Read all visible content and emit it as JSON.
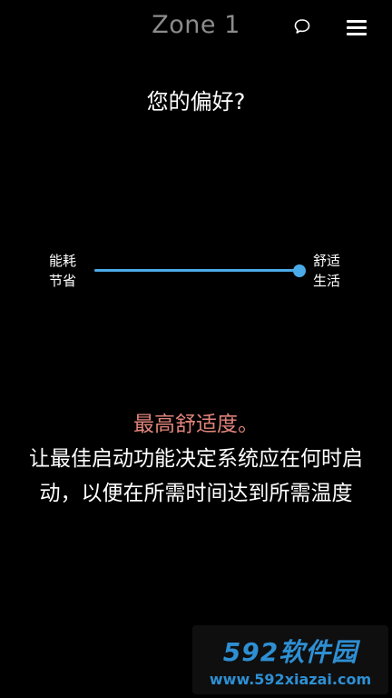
{
  "header": {
    "title": "Zone 1",
    "chat_icon": "speech-bubble-icon",
    "menu_icon": "hamburger-menu-icon"
  },
  "question": "您的偏好?",
  "slider": {
    "left_label_line1": "能耗",
    "left_label_line2": "节省",
    "right_label_line1": "舒适",
    "right_label_line2": "生活",
    "value_percent": 100,
    "accent_color": "#4aabe8"
  },
  "description": {
    "title": "最高舒适度。",
    "body": "让最佳启动功能决定系统应在何时启动，以便在所需时间达到所需温度",
    "title_color": "#e0847b"
  },
  "watermark": {
    "brand": "592软件园",
    "url": "www.592xiazai.com"
  }
}
